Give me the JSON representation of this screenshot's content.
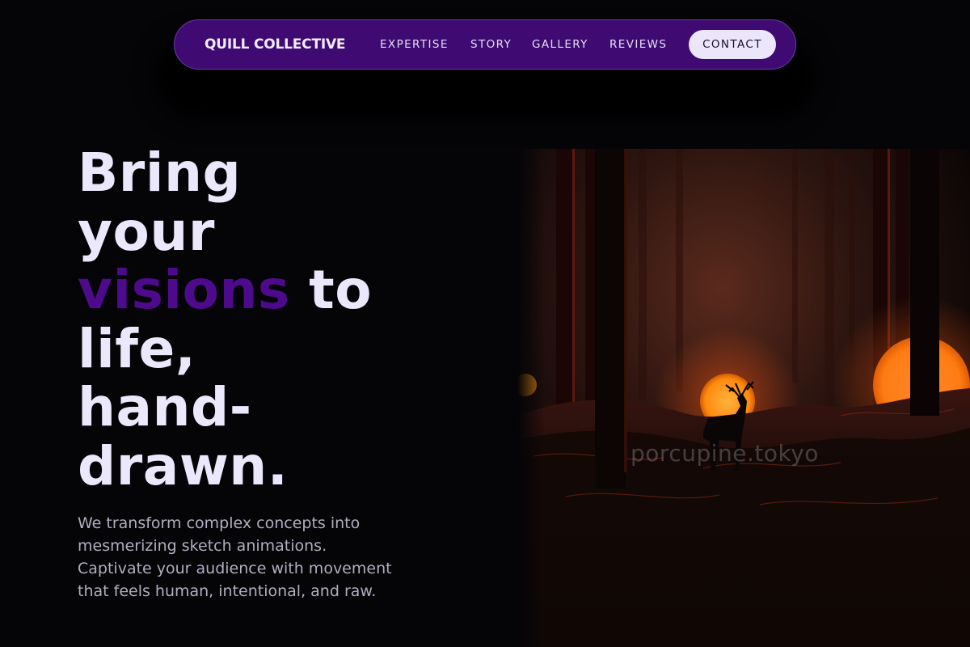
{
  "nav": {
    "brand": "QUILL COLLECTIVE",
    "links": [
      "EXPERTISE",
      "STORY",
      "GALLERY",
      "REVIEWS"
    ],
    "cta": "CONTACT"
  },
  "hero": {
    "headline_lines": {
      "line1": "Bring",
      "line2": "your",
      "line3_accent": "visions",
      "line3_rest": " to",
      "line4": "life,",
      "line5": "hand-",
      "line6": "drawn."
    },
    "subtext": "We transform complex concepts into mesmerizing sketch animations. Captivate your audience with movement that feels human, intentional, and raw.",
    "image_watermark": "porcupine.tokyo"
  },
  "colors": {
    "nav_background": "#3f0a72",
    "accent": "#4e0a8c",
    "headline": "#ece8fb",
    "page_background": "#050407",
    "cta_background": "#ece6fb"
  }
}
